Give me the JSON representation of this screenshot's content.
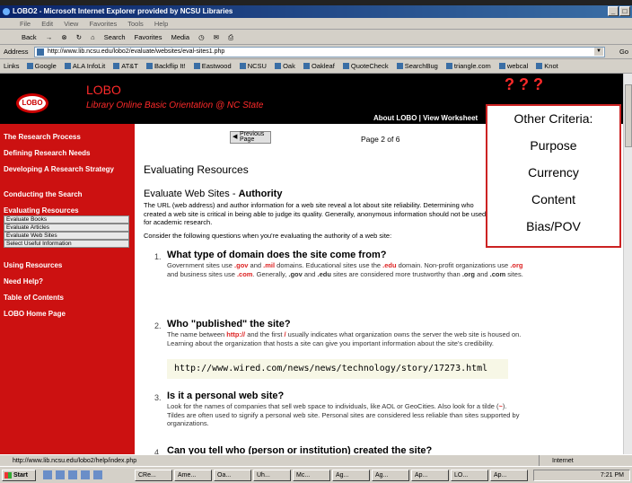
{
  "window": {
    "title": "LOBO2 - Microsoft Internet Explorer provided by NCSU Libraries",
    "menu": [
      "File",
      "Edit",
      "View",
      "Favorites",
      "Tools",
      "Help"
    ],
    "toolbar": [
      "Back",
      "Search",
      "Favorites",
      "Media"
    ],
    "address_label": "Address",
    "address": "http://www.lib.ncsu.edu/lobo2/evaluate/websites/eval-sites1.php",
    "go": "Go",
    "links_label": "Links",
    "links": [
      "Google",
      "ALA InfoLit",
      "AT&T",
      "Backflip It!",
      "Eastwood",
      "NCSU",
      "Oak",
      "Oakleaf",
      "QuoteCheck",
      "SearchBug",
      "triangle.com",
      "webcal",
      "Knot"
    ]
  },
  "site": {
    "logo": "LOBO",
    "title": "LOBO",
    "subtitle": "Library Online Basic Orientation @ NC State",
    "qmarks": "? ? ?",
    "header_links": "About LOBO | View Worksheet"
  },
  "nav": {
    "items": [
      "The Research Process",
      "Defining Research Needs",
      "Developing A Research Strategy",
      "Conducting the Search",
      "Evaluating Resources",
      "Using Resources",
      "Need Help?",
      "Table of Contents",
      "LOBO Home Page"
    ],
    "subitems": [
      "Evaluate Books",
      "Evaluate Articles",
      "Evaluate Web Sites",
      "Select Useful Information"
    ]
  },
  "main": {
    "prev_label": "Previous Page",
    "pager": "Page 2 of 6",
    "heading": "Evaluating Resources",
    "subheading_a": "Evaluate Web Sites - ",
    "subheading_b": "Authority",
    "intro": "The URL (web address) and author information for a web site reveal a lot about site reliability. Determining who created a web site is critical in being able to judge its quality. Generally, anonymous information should not be used for academic research.",
    "consider": "Consider the following questions when you're evaluating the authority of a web site:",
    "q1_title": "What type of domain does the site come from?",
    "q1_text": "Government sites use .gov and .mil domains. Educational sites use the .edu domain. Non-profit organizations use .org and business sites use .com. Generally, .gov and .edu sites are considered more trustworthy than .org and .com sites.",
    "q2_title": "Who \"published\" the site?",
    "q2_text": "The name between http:// and the first / usually indicates what organization owns the server the web site is housed on. Learning about the organization that hosts a site can give you important information about the site's credibility.",
    "example_url": "http://www.wired.com/news/news/technology/story/17273.html",
    "q3_title": "Is it a personal web site?",
    "q3_text": "Look for the names of companies that sell web space to individuals, like AOL or GeoCities. Also look for a tilde (~). Tildes are often used to signify a personal web site. Personal sites are considered less reliable than sites supported by organizations.",
    "q4_title": "Can you tell who (person or institution) created the site?",
    "nums": [
      "1.",
      "2.",
      "3.",
      "4."
    ]
  },
  "criteria": {
    "title": "Other Criteria:",
    "items": [
      "Purpose",
      "Currency",
      "Content",
      "Bias/POV"
    ]
  },
  "status": {
    "url": "http://www.lib.ncsu.edu/lobo2/help/index.php",
    "zone": "Internet"
  },
  "taskbar": {
    "start": "Start",
    "tasks": [
      "CRe...",
      "Ame...",
      "Oa...",
      "Uh...",
      "Mc...",
      "Ag...",
      "Ag...",
      "Ap...",
      "LO...",
      "Ap..."
    ],
    "clock": "7:21 PM"
  }
}
